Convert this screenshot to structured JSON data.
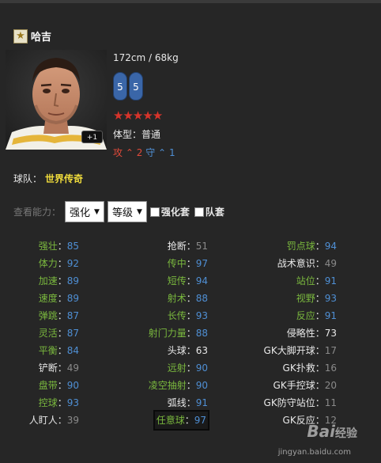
{
  "player": {
    "name": "哈吉",
    "height_weight": "172cm / 68kg",
    "foot_left": "5",
    "foot_right": "5",
    "stars": "★★★★★",
    "body_type": "体型：普通",
    "jersey_badge": "+1",
    "attack_label": "攻",
    "attack_value": "2",
    "defense_label": "守",
    "defense_value": "1"
  },
  "team": {
    "label": "球队：",
    "name": "世界传奇"
  },
  "controls": {
    "label": "查看能力：",
    "select1": "强化",
    "select2": "等级",
    "check1": "强化套",
    "check2": "队套"
  },
  "stats_rows": [
    [
      {
        "name": "强壮",
        "value": "85"
      },
      {
        "name": "抢断",
        "value": "51"
      },
      {
        "name": "罚点球",
        "value": "94"
      }
    ],
    [
      {
        "name": "体力",
        "value": "92"
      },
      {
        "name": "传中",
        "value": "97"
      },
      {
        "name": "战术意识",
        "value": "49"
      }
    ],
    [
      {
        "name": "加速",
        "value": "89"
      },
      {
        "name": "短传",
        "value": "94"
      },
      {
        "name": "站位",
        "value": "91"
      }
    ],
    [
      {
        "name": "速度",
        "value": "89"
      },
      {
        "name": "射术",
        "value": "88"
      },
      {
        "name": "视野",
        "value": "93"
      }
    ],
    [
      {
        "name": "弹跳",
        "value": "87"
      },
      {
        "name": "长传",
        "value": "93"
      },
      {
        "name": "反应",
        "value": "91"
      }
    ],
    [
      {
        "name": "灵活",
        "value": "87"
      },
      {
        "name": "射门力量",
        "value": "88"
      },
      {
        "name": "侵略性",
        "value": "73"
      }
    ],
    [
      {
        "name": "平衡",
        "value": "84"
      },
      {
        "name": "头球",
        "value": "63"
      },
      {
        "name": "GK大脚开球",
        "value": "17"
      }
    ],
    [
      {
        "name": "铲断",
        "value": "49"
      },
      {
        "name": "远射",
        "value": "90"
      },
      {
        "name": "GK扑救",
        "value": "16"
      }
    ],
    [
      {
        "name": "盘带",
        "value": "90"
      },
      {
        "name": "凌空抽射",
        "value": "90"
      },
      {
        "name": "GK手控球",
        "value": "20"
      }
    ],
    [
      {
        "name": "控球",
        "value": "93"
      },
      {
        "name": "弧线",
        "value": "91"
      },
      {
        "name": "GK防守站位",
        "value": "11"
      }
    ],
    [
      {
        "name": "人盯人",
        "value": "39"
      },
      {
        "name": "任意球",
        "value": "97"
      },
      {
        "name": "GK反应",
        "value": "12"
      }
    ]
  ],
  "colors": {
    "green": "#7ab83e",
    "blue": "#4f8fd4",
    "gray": "#8a8a8a",
    "white": "#e8e8e8",
    "team": "#f0dc3c",
    "stars": "#d8342b"
  },
  "watermark": {
    "brand": "Bai",
    "brand2": "经验",
    "url": "jingyan.baidu.com"
  }
}
